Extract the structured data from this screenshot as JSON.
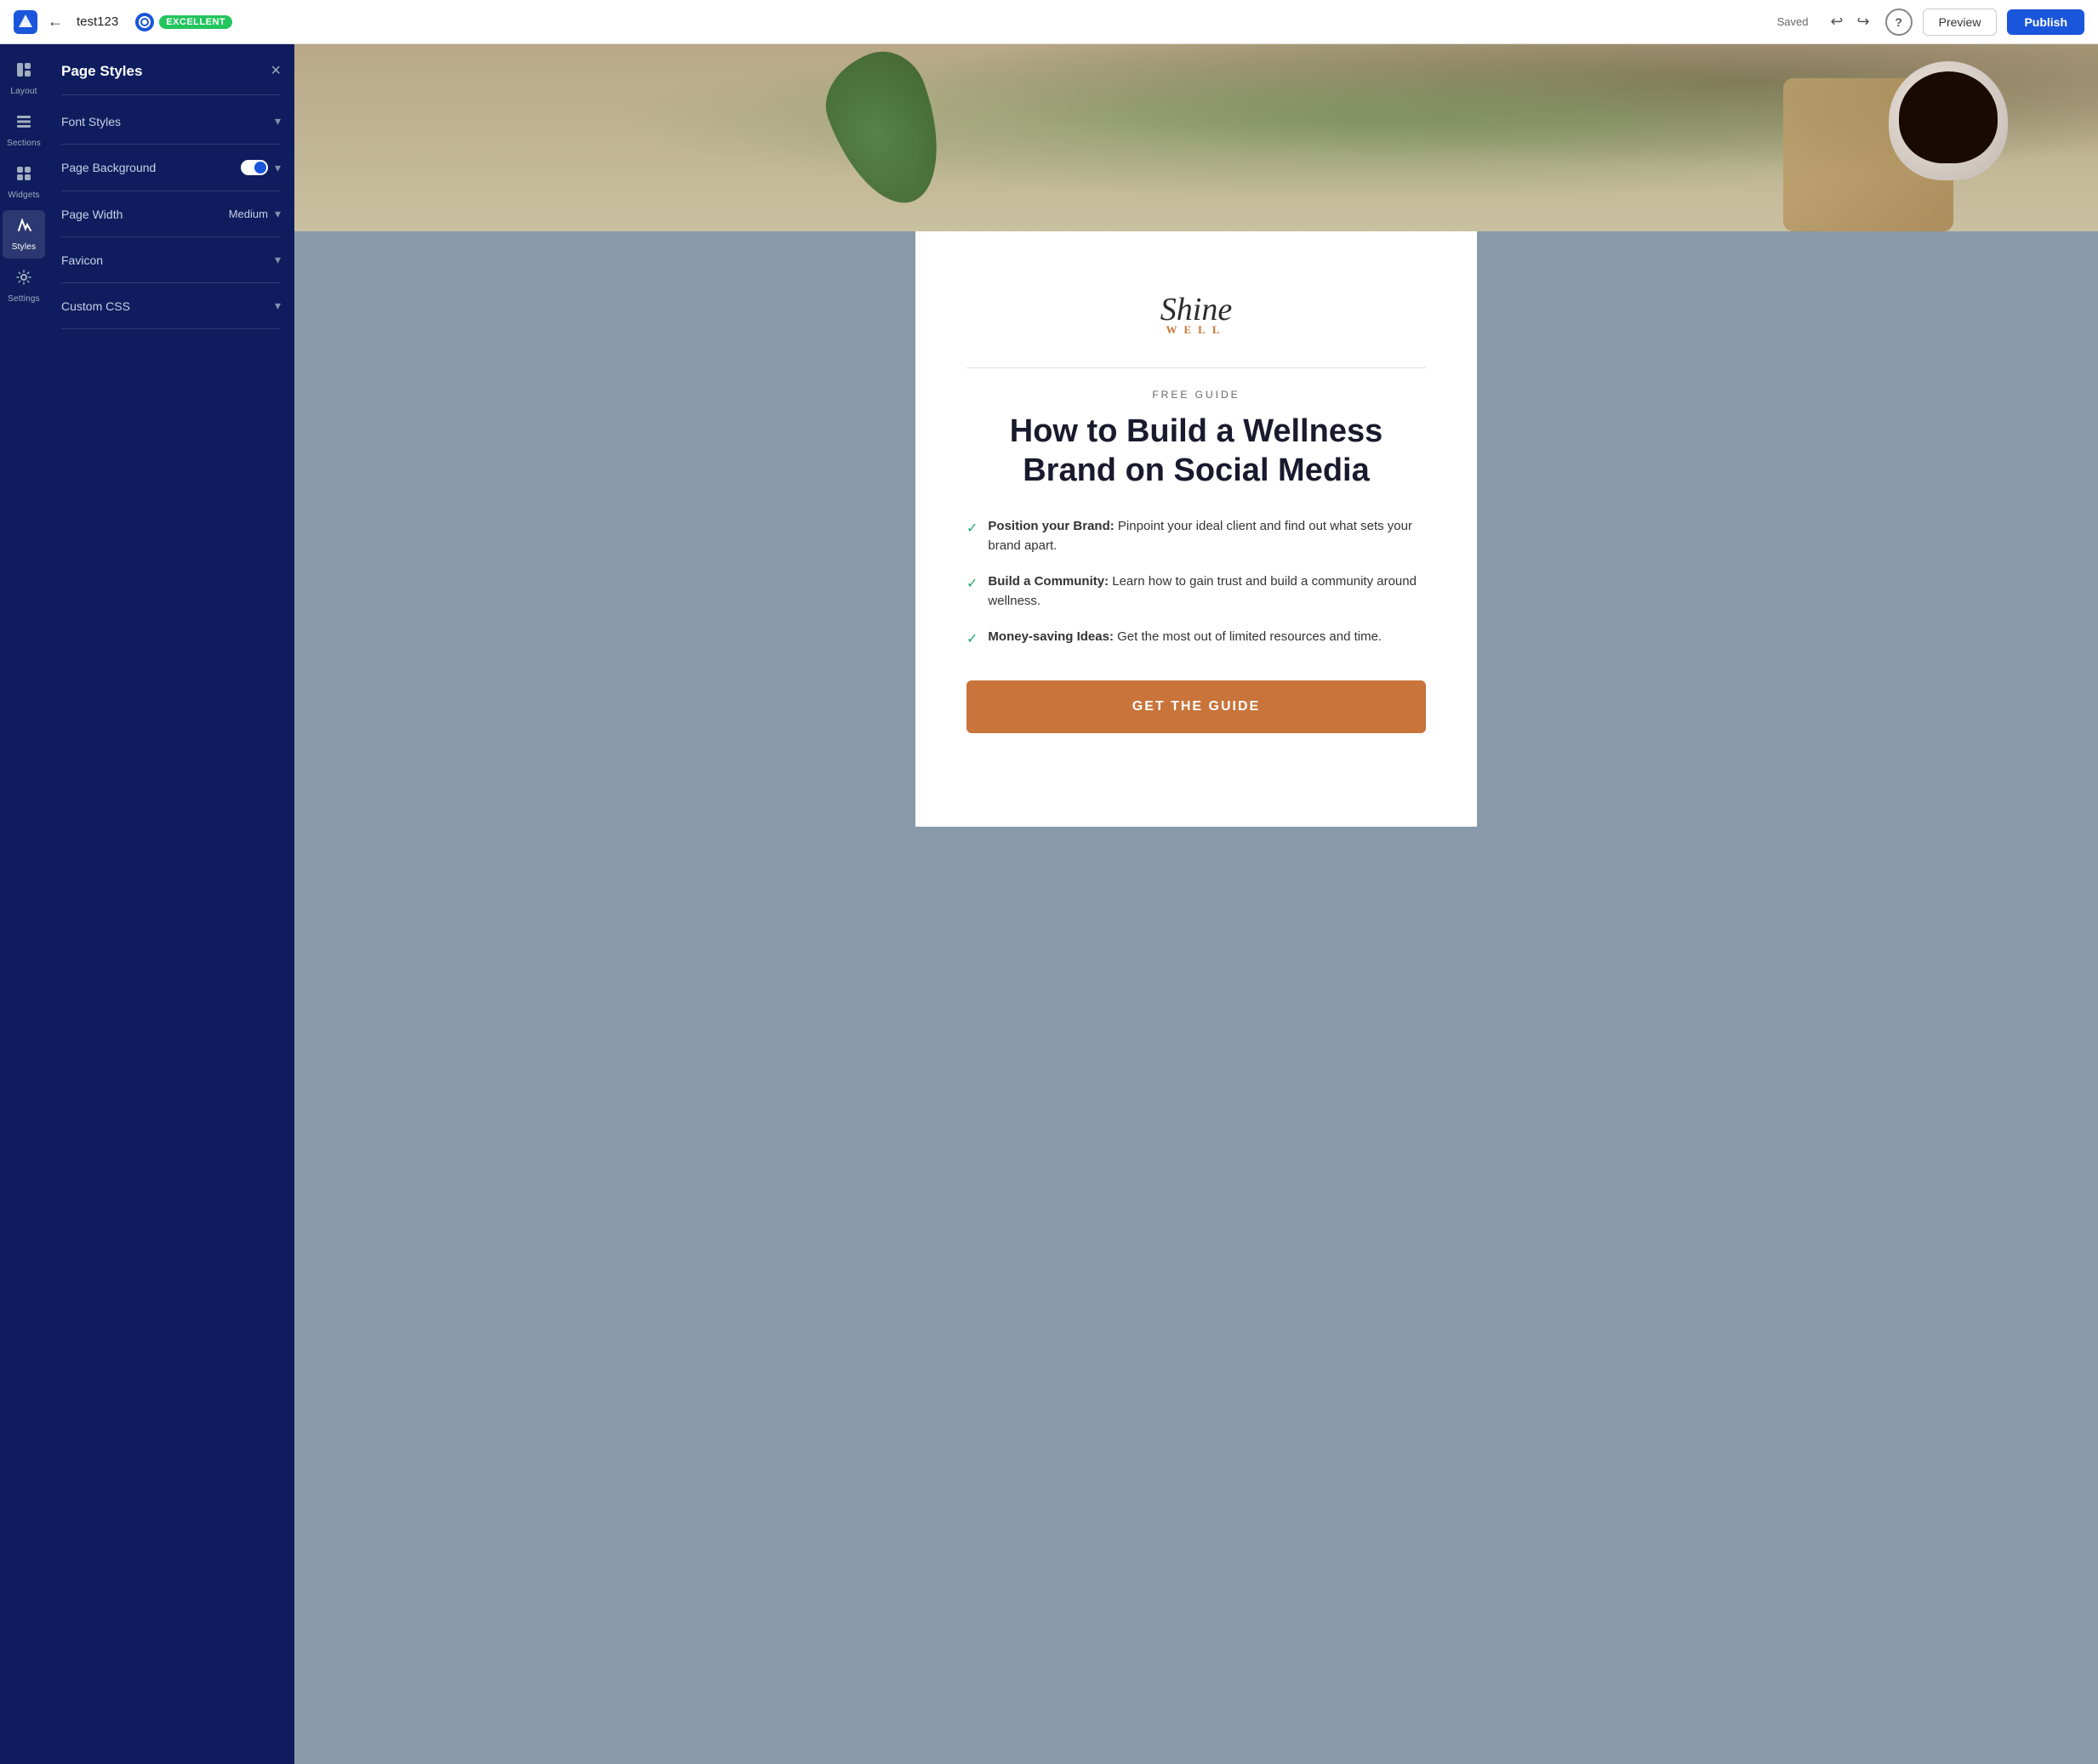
{
  "topbar": {
    "logo_label": "App Logo",
    "back_label": "←",
    "title": "test123",
    "badge_quality": "EXCELLENT",
    "saved_label": "Saved",
    "undo_label": "↩",
    "redo_label": "↪",
    "help_label": "?",
    "preview_label": "Preview",
    "publish_label": "Publish"
  },
  "sidebar_icons": [
    {
      "id": "layout",
      "symbol": "⊞",
      "label": "Layout"
    },
    {
      "id": "sections",
      "symbol": "▤",
      "label": "Sections"
    },
    {
      "id": "widgets",
      "symbol": "⊞",
      "label": "Widgets"
    },
    {
      "id": "styles",
      "symbol": "✏",
      "label": "Styles",
      "active": true
    },
    {
      "id": "settings",
      "symbol": "⚙",
      "label": "Settings"
    }
  ],
  "panel": {
    "title": "Page Styles",
    "close_label": "×",
    "sections": [
      {
        "id": "font-styles",
        "label": "Font Styles",
        "value": "",
        "has_toggle": false
      },
      {
        "id": "page-background",
        "label": "Page Background",
        "value": "",
        "has_toggle": true
      },
      {
        "id": "page-width",
        "label": "Page Width",
        "value": "Medium",
        "has_toggle": false
      },
      {
        "id": "favicon",
        "label": "Favicon",
        "value": "",
        "has_toggle": false
      },
      {
        "id": "custom-css",
        "label": "Custom CSS",
        "value": "",
        "has_toggle": false
      }
    ]
  },
  "page_content": {
    "brand_name": "Shine",
    "brand_sub": "WELL",
    "divider": "",
    "free_guide": "FREE GUIDE",
    "title_line1": "How to Build a Wellness",
    "title_line2": "Brand on Social Media",
    "features": [
      {
        "bold": "Position your Brand:",
        "text": " Pinpoint your ideal client and find out what sets your brand apart."
      },
      {
        "bold": "Build a Community:",
        "text": " Learn how to gain trust and build a community around wellness."
      },
      {
        "bold": "Money-saving Ideas:",
        "text": " Get the most out of limited resources and time."
      }
    ],
    "cta_label": "GET THE GUIDE"
  },
  "colors": {
    "topbar_bg": "#ffffff",
    "sidebar_bg": "#0f1d5e",
    "accent_blue": "#1a56db",
    "brand_orange": "#c8743a",
    "check_green": "#22a86e",
    "publish_bg": "#1a56db",
    "badge_bg": "#22c55e"
  }
}
